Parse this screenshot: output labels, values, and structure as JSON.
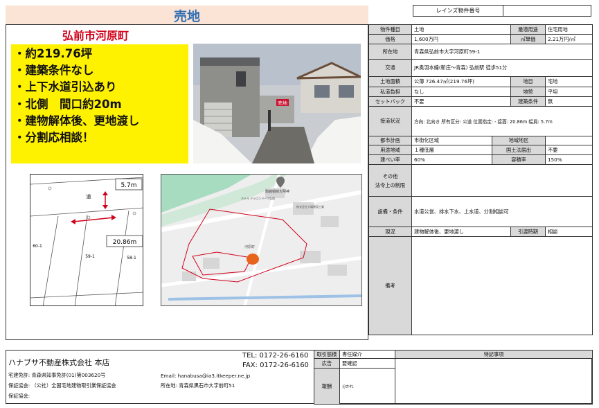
{
  "header": {
    "title": "売地",
    "reins_label": "レインズ物件番号",
    "reins_value": ""
  },
  "city_title": "弘前市河原町",
  "highlights": [
    "・約219.76坪",
    "・建築条件なし",
    "・上下水道引込あり",
    "・北側　間口約20m",
    "・建物解体後、更地渡し",
    "・分割応相談！"
  ],
  "photo": {
    "sign_text": "売地"
  },
  "plan": {
    "road_label": "道",
    "frontage_width": "5.7m",
    "frontage_length": "20.86m",
    "lot_main": "59-1",
    "lot_left": "60-1",
    "lot_right": "58-1"
  },
  "map": {
    "label_station_building": "駒越稲荷大明神",
    "label_hotel": "ホテル ドラゴンリーフ弘前",
    "label_company": "株式会社大場建設工業",
    "label_kawaramachi": "河原町"
  },
  "info": {
    "type_label": "物件種目",
    "type_value": "土地",
    "purpose_label": "最適用途",
    "purpose_value": "住宅用地",
    "price_label": "価格",
    "price_value": "1,600万円",
    "unit_price_label": "㎡単価",
    "unit_price_value": "2.21万円/㎡",
    "address_label": "所在地",
    "address_value": "青森県弘前市大字河原町59-1",
    "transit_label": "交通",
    "transit_value": "JR奥羽本線(新庄～青森) 弘前駅 徒歩51分",
    "area_label": "土地面積",
    "area_value": "公簿 726.47㎡(219.76坪)",
    "land_cat_label": "地目",
    "land_cat_value": "宅地",
    "private_road_label": "私道負担",
    "private_road_value": "なし",
    "terrain_label": "地勢",
    "terrain_value": "平坦",
    "setback_label": "セットバック",
    "setback_value": "不要",
    "build_cond_label": "建築条件",
    "build_cond_value": "無",
    "road_access_label": "接道状況",
    "road_access_value": "方向: 北向き 所有区分: 公道 位置指定: - 接面: 20.86m 幅員: 5.7m",
    "city_plan_label": "都市計画",
    "city_plan_value": "市街化区域",
    "district_label": "地域地区",
    "district_value": "",
    "zoning_label": "用途地域",
    "zoning_value": "１種低層",
    "land_act_label": "国土法届出",
    "land_act_value": "不要",
    "coverage_label": "建ぺい率",
    "coverage_value": "60%",
    "far_label": "容積率",
    "far_value": "150%",
    "other_label_1": "その他",
    "other_label_2": "法令上の制限",
    "other_value": "",
    "facility_label": "設備・条件",
    "facility_value": "水道公営、排水下水、上水道、分割相談可",
    "current_label": "現況",
    "current_value": "建物解体後、更地渡し",
    "handover_label": "引渡時期",
    "handover_value": "相談",
    "remarks_label": "備考",
    "remarks_value": ""
  },
  "footer": {
    "company": "ハナブサ不動産株式会社 本店",
    "license": "宅建免許: 青森県知事免許(01)第003620号",
    "guarantee": "保証協会: （公社）全国宅地建物取引業保証協会",
    "guarantee2": "保証協会:",
    "tel": "TEL: 0172-26-6160",
    "fax": "FAX: 0172-26-6160",
    "email": "Email: hanabusa@ia3.itkeeper.ne.jp",
    "address": "所在地: 青森県黒石市大字前町51",
    "deal_label": "取引態様",
    "deal_value": "専任媒介",
    "ad_label": "広告",
    "ad_value": "要確認",
    "fee_label": "報酬",
    "fee_value": "分かれ",
    "notes_label": "特記事項",
    "notes_value": ""
  }
}
